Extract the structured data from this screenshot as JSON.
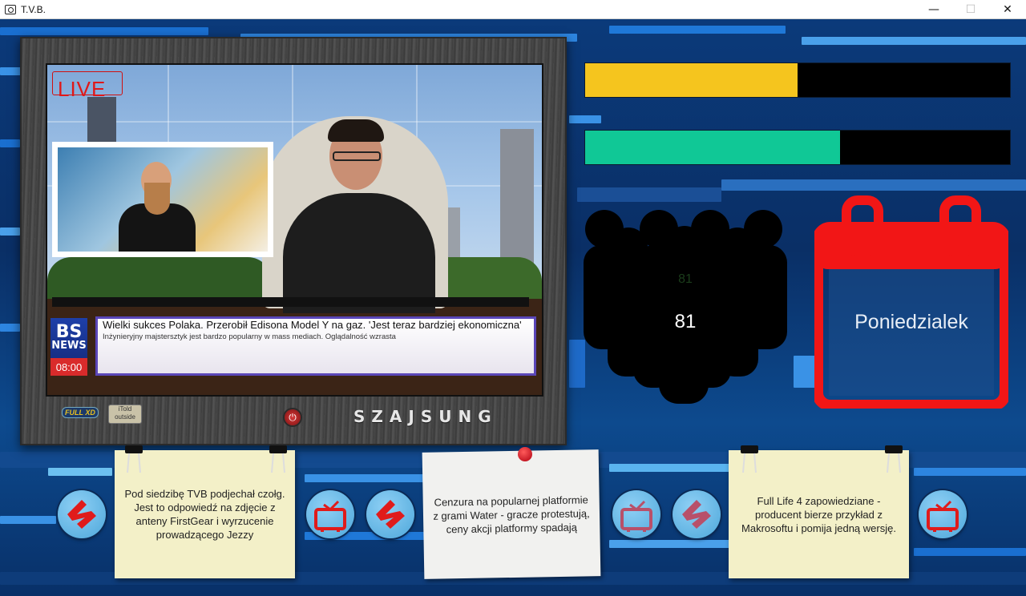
{
  "window": {
    "title": "T.V.B.",
    "minimize": "—",
    "maximize": "☐",
    "close": "✕"
  },
  "tv": {
    "live_label": "LIVE",
    "news_logo_top": "BS",
    "news_logo_bottom": "NEWS",
    "time": "08:00",
    "headline": "Wielki sukces Polaka. Przerobił Edisona Model Y na gaz. 'Jest teraz bardziej ekonomiczna'",
    "subline": "Inżynieryjny majstersztyk jest bardzo popularny w mass mediach. Oglądalność wzrasta",
    "logo_left": "FULL XD",
    "logo_mid": "iTold outside",
    "brand": "SZAJSUNG"
  },
  "meters": {
    "top_fill": 0.5,
    "top_color": "#f5c51e",
    "bottom_fill": 0.6,
    "bottom_color": "#10c896"
  },
  "audience": {
    "count": "81",
    "ghost_count": "81"
  },
  "calendar": {
    "day": "Poniedzialek",
    "color": "#f21616"
  },
  "notes": [
    {
      "text": "Pod siedzibę TVB podjechał czołg. Jest to odpowiedź na zdjęcie z anteny FirstGear i wyrzucenie prowadzącego Jezzy"
    },
    {
      "text": "Cenzura na popularnej platformie z grami Water - gracze protestują, ceny akcji platformy spadają"
    },
    {
      "text": "Full Life 4 zapowiedziane - producent bierze przykład z Makrosoftu i pomija jedną wersję."
    }
  ],
  "icons": {
    "reject": "reject-icon",
    "tv": "tv-icon"
  }
}
